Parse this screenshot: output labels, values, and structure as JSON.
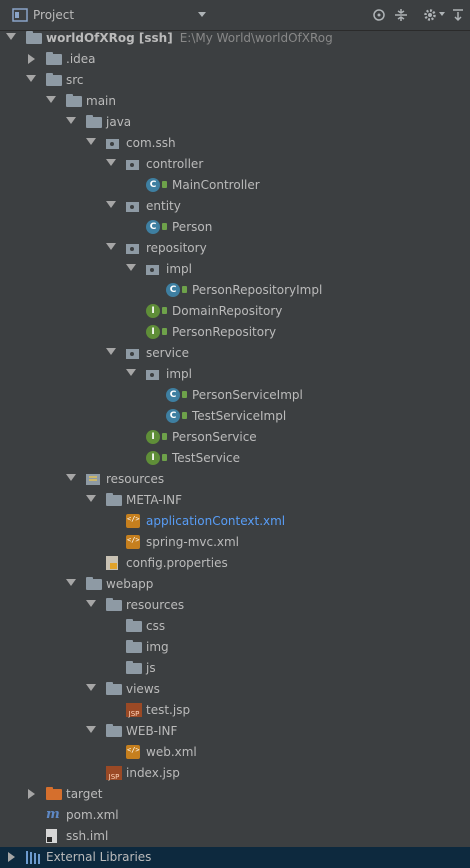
{
  "toolbar": {
    "title": "Project",
    "icons": [
      "project-view-icon",
      "dropdown-arrow-icon",
      "crosshair-locate-icon",
      "collapse-all-icon",
      "gear-icon",
      "hide-panel-icon"
    ]
  },
  "tree": [
    {
      "label": "worldOfXRog [ssh]",
      "path": "E:\\My World\\worldOfXRog",
      "icon": "module-folder-icon",
      "expanded": true,
      "depth": 0
    },
    {
      "label": ".idea",
      "icon": "folder-icon",
      "expanded": false,
      "depth": 1
    },
    {
      "label": "src",
      "icon": "folder-icon",
      "expanded": true,
      "depth": 1
    },
    {
      "label": "main",
      "icon": "folder-icon",
      "expanded": true,
      "depth": 2
    },
    {
      "label": "java",
      "icon": "source-folder-icon",
      "expanded": true,
      "depth": 3
    },
    {
      "label": "com.ssh",
      "icon": "package-icon",
      "expanded": true,
      "depth": 4
    },
    {
      "label": "controller",
      "icon": "package-icon",
      "expanded": true,
      "depth": 5
    },
    {
      "label": "MainController",
      "icon": "class-icon",
      "depth": 6
    },
    {
      "label": "entity",
      "icon": "package-icon",
      "expanded": true,
      "depth": 5
    },
    {
      "label": "Person",
      "icon": "class-icon",
      "depth": 6
    },
    {
      "label": "repository",
      "icon": "package-icon",
      "expanded": true,
      "depth": 5
    },
    {
      "label": "impl",
      "icon": "package-icon",
      "expanded": true,
      "depth": 6
    },
    {
      "label": "PersonRepositoryImpl",
      "icon": "class-icon",
      "depth": 7
    },
    {
      "label": "DomainRepository",
      "icon": "interface-icon",
      "depth": 6
    },
    {
      "label": "PersonRepository",
      "icon": "interface-icon",
      "depth": 6
    },
    {
      "label": "service",
      "icon": "package-icon",
      "expanded": true,
      "depth": 5
    },
    {
      "label": "impl",
      "icon": "package-icon",
      "expanded": true,
      "depth": 6
    },
    {
      "label": "PersonServiceImpl",
      "icon": "class-icon",
      "depth": 7
    },
    {
      "label": "TestServiceImpl",
      "icon": "class-icon",
      "depth": 7
    },
    {
      "label": "PersonService",
      "icon": "interface-icon",
      "depth": 6
    },
    {
      "label": "TestService",
      "icon": "interface-icon",
      "depth": 6
    },
    {
      "label": "resources",
      "icon": "resources-folder-icon",
      "expanded": true,
      "depth": 3
    },
    {
      "label": "META-INF",
      "icon": "folder-icon",
      "expanded": true,
      "depth": 4
    },
    {
      "label": "applicationContext.xml",
      "icon": "spring-xml-icon",
      "depth": 5,
      "link": true
    },
    {
      "label": "spring-mvc.xml",
      "icon": "spring-xml-icon",
      "depth": 5
    },
    {
      "label": "config.properties",
      "icon": "properties-file-icon",
      "depth": 4
    },
    {
      "label": "webapp",
      "icon": "web-folder-icon",
      "expanded": true,
      "depth": 3
    },
    {
      "label": "resources",
      "icon": "folder-icon",
      "expanded": true,
      "depth": 4
    },
    {
      "label": "css",
      "icon": "folder-icon",
      "depth": 5
    },
    {
      "label": "img",
      "icon": "folder-icon",
      "depth": 5
    },
    {
      "label": "js",
      "icon": "folder-icon",
      "depth": 5
    },
    {
      "label": "views",
      "icon": "folder-icon",
      "expanded": true,
      "depth": 4
    },
    {
      "label": "test.jsp",
      "icon": "jsp-file-icon",
      "depth": 5
    },
    {
      "label": "WEB-INF",
      "icon": "folder-icon",
      "expanded": true,
      "depth": 4
    },
    {
      "label": "web.xml",
      "icon": "xml-file-icon",
      "depth": 5
    },
    {
      "label": "index.jsp",
      "icon": "jsp-file-icon",
      "depth": 4
    },
    {
      "label": "target",
      "icon": "excluded-folder-icon",
      "expanded": false,
      "depth": 1
    },
    {
      "label": "pom.xml",
      "icon": "maven-icon",
      "depth": 1
    },
    {
      "label": "ssh.iml",
      "icon": "iml-file-icon",
      "depth": 1
    },
    {
      "label": "External Libraries",
      "icon": "libraries-icon",
      "expanded": false,
      "depth": 0,
      "selected": true
    }
  ]
}
